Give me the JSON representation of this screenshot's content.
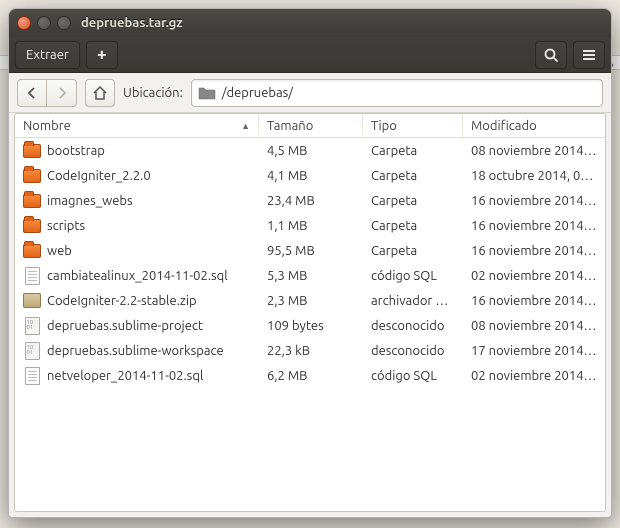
{
  "bg_hint": "2,",
  "window": {
    "title": "depruebas.tar.gz"
  },
  "toolbar": {
    "extract_label": "Extraer",
    "add_label": "+"
  },
  "nav": {
    "location_label": "Ubicación:",
    "path": "/depruebas/"
  },
  "columns": {
    "name": "Nombre",
    "size": "Tamaño",
    "type": "Tipo",
    "modified": "Modificado"
  },
  "files": [
    {
      "icon": "folder",
      "name": "bootstrap",
      "size": "4,5 MB",
      "type": "Carpeta",
      "modified": "08 noviembre 2014…"
    },
    {
      "icon": "folder",
      "name": "CodeIgniter_2.2.0",
      "size": "4,1 MB",
      "type": "Carpeta",
      "modified": "18 octubre 2014, 0…"
    },
    {
      "icon": "folder",
      "name": "imagnes_webs",
      "size": "23,4 MB",
      "type": "Carpeta",
      "modified": "16 noviembre 2014…"
    },
    {
      "icon": "folder",
      "name": "scripts",
      "size": "1,1 MB",
      "type": "Carpeta",
      "modified": "16 noviembre 2014…"
    },
    {
      "icon": "folder",
      "name": "web",
      "size": "95,5 MB",
      "type": "Carpeta",
      "modified": "16 noviembre 2014…"
    },
    {
      "icon": "file",
      "name": "cambiatealinux_2014-11-02.sql",
      "size": "5,3 MB",
      "type": "código SQL",
      "modified": "02 noviembre 2014…"
    },
    {
      "icon": "zip",
      "name": "CodeIgniter-2.2-stable.zip",
      "size": "2,3 MB",
      "type": "archivador …",
      "modified": "16 noviembre 2014…"
    },
    {
      "icon": "bin",
      "name": "depruebas.sublime-project",
      "size": "109 bytes",
      "type": "desconocido",
      "modified": "08 noviembre 2014…"
    },
    {
      "icon": "bin",
      "name": "depruebas.sublime-workspace",
      "size": "22,3 kB",
      "type": "desconocido",
      "modified": "17 noviembre 2014…"
    },
    {
      "icon": "file",
      "name": "netveloper_2014-11-02.sql",
      "size": "6,2 MB",
      "type": "código SQL",
      "modified": "02 noviembre 2014…"
    }
  ]
}
